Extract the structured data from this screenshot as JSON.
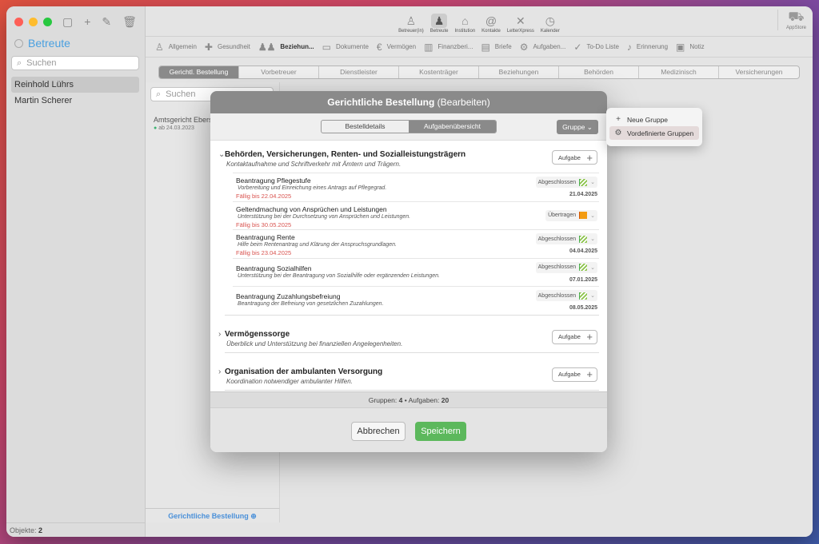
{
  "sidebar": {
    "title": "Betreute",
    "search_placeholder": "Suchen",
    "items": [
      "Reinhold Lührs",
      "Martin Scherer"
    ],
    "footer_label": "Objekte:",
    "footer_count": "2"
  },
  "toolbar": {
    "buttons": [
      {
        "label": "Betreuer(in)",
        "icon": "person-outline-icon"
      },
      {
        "label": "Betreute",
        "icon": "person-icon"
      },
      {
        "label": "Institution",
        "icon": "building-icon"
      },
      {
        "label": "Kontakte",
        "icon": "contacts-icon"
      },
      {
        "label": "LetterXpress",
        "icon": "letterxpress-icon"
      },
      {
        "label": "Kalender",
        "icon": "clock-icon"
      }
    ],
    "appstore": "AppStore"
  },
  "nav": [
    "Allgemein",
    "Gesundheit",
    "Beziehun...",
    "Dokumente",
    "Vermögen",
    "Finanzberi...",
    "Briefe",
    "Aufgaben...",
    "To-Do Liste",
    "Erinnerung",
    "Notiz"
  ],
  "subtabs": [
    "Gerichtl. Bestellung",
    "Vorbetreuer",
    "Dienstleister",
    "Kostenträger",
    "Beziehungen",
    "Behörden",
    "Medizinisch",
    "Versicherungen"
  ],
  "listcol": {
    "search_placeholder": "Suchen",
    "item_title": "Amtsgericht Ebers",
    "item_sub": "ab 24.03.2023",
    "footer": "Gerichtliche Bestellung"
  },
  "modal": {
    "title": "Gerichtliche Bestellung",
    "title_suffix": "(Bearbeiten)",
    "seg_left": "Bestelldetails",
    "seg_right": "Aufgabenübersicht",
    "gruppe_label": "Gruppe",
    "add_label": "Aufgabe",
    "groups": [
      {
        "title": "Behörden, Versicherungen, Renten- und Sozialleistungsträgern",
        "desc": "Kontaktaufnahme und Schriftverkehr mit Ämtern und Trägern.",
        "tasks": [
          {
            "title": "Beantragung Pflegestufe",
            "desc": "Vorbereitung und Einreichung eines Antrags auf Pflegegrad.",
            "due": "Fällig bis 22.04.2025",
            "status": "Abgeschlossen",
            "date": "21.04.2025"
          },
          {
            "title": "Geltendmachung von Ansprüchen und Leistungen",
            "desc": "Unterstützung bei der Durchsetzung von Ansprüchen und Leistungen.",
            "due": "Fällig bis 30.05.2025",
            "status": "Übertragen",
            "date": ""
          },
          {
            "title": "Beantragung Rente",
            "desc": "Hilfe beim Rentenantrag und Klärung der Anspruchsgrundlagen.",
            "due": "Fällig bis 23.04.2025",
            "status": "Abgeschlossen",
            "date": "04.04.2025"
          },
          {
            "title": "Beantragung Sozialhilfen",
            "desc": "Unterstützung bei der Beantragung von Sozialhilfe oder ergänzenden Leistungen.",
            "due": "",
            "status": "Abgeschlossen",
            "date": "07.01.2025"
          },
          {
            "title": "Beantragung Zuzahlungsbefreiung",
            "desc": "Beantragung der Befreiung von gesetzlichen Zuzahlungen.",
            "due": "",
            "status": "Abgeschlossen",
            "date": "08.05.2025"
          }
        ]
      },
      {
        "title": "Vermögenssorge",
        "desc": "Überblick und Unterstützung bei finanziellen Angelegenheiten."
      },
      {
        "title": "Organisation der ambulanten Versorgung",
        "desc": "Koordination notwendiger ambulanter Hilfen."
      }
    ],
    "stats_prefix": "Gruppen:",
    "stats_groups": "4",
    "stats_mid": "Aufgaben:",
    "stats_tasks": "20",
    "cancel": "Abbrechen",
    "save": "Speichern"
  },
  "popover": {
    "items": [
      "Neue Gruppe",
      "Vordefinierte Gruppen"
    ]
  }
}
